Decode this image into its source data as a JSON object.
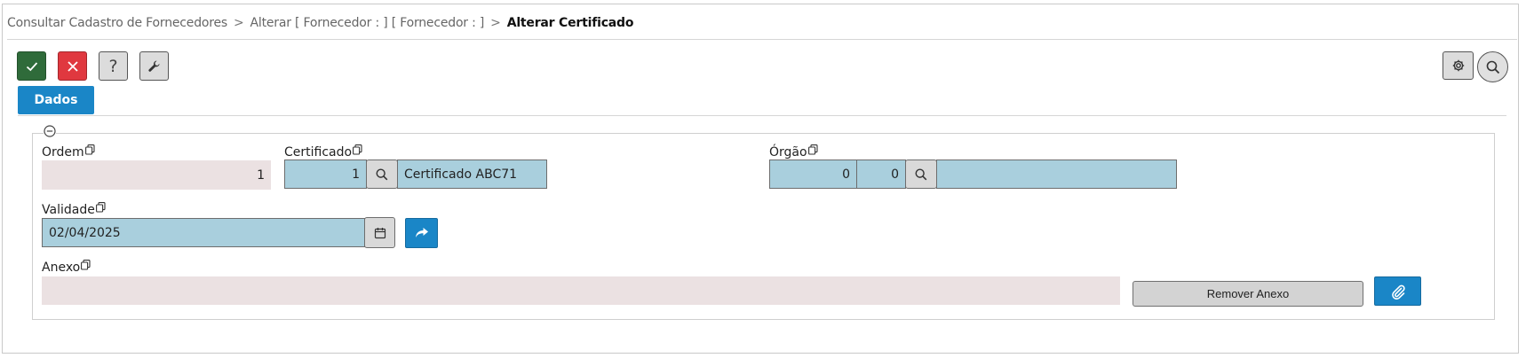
{
  "breadcrumb": {
    "items": [
      "Consultar Cadastro de Fornecedores",
      "Alterar [ Fornecedor : ] [ Fornecedor : ]",
      "Alterar Certificado"
    ],
    "separator": ">"
  },
  "toolbar": {
    "confirm_icon": "check-icon",
    "cancel_icon": "close-icon",
    "help_label": "?",
    "tools_icon": "wrench-icon",
    "settings_icon": "gear-icon",
    "search_icon": "search-icon"
  },
  "tabs": [
    {
      "label": "Dados",
      "active": true
    }
  ],
  "form": {
    "ordem": {
      "label": "Ordem",
      "value": "1"
    },
    "certificado": {
      "label": "Certificado",
      "code": "1",
      "description": "Certificado ABC71"
    },
    "orgao": {
      "label": "Órgão",
      "code1": "0",
      "code2": "0",
      "description": ""
    },
    "validade": {
      "label": "Validade",
      "value": "02/04/2025"
    },
    "anexo": {
      "label": "Anexo",
      "value": "",
      "remove_label": "Remover Anexo"
    }
  },
  "colors": {
    "accent": "#1a86c7",
    "confirm": "#2f6b3a",
    "cancel": "#e0383f",
    "editable_field": "#a9cfdd",
    "readonly_field": "#ebe1e2"
  }
}
